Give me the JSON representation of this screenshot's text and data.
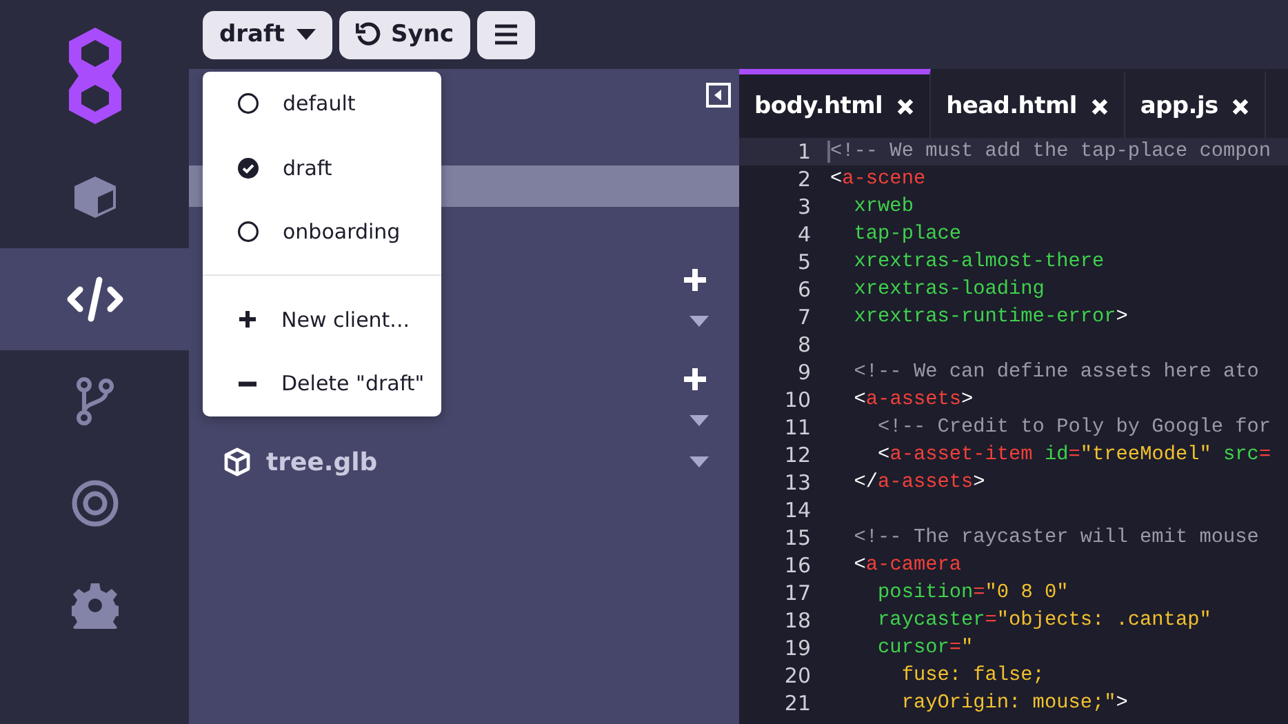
{
  "rail": {
    "items": [
      {
        "kind": "cube",
        "selected": false
      },
      {
        "kind": "code",
        "selected": true
      },
      {
        "kind": "branch",
        "selected": false
      },
      {
        "kind": "target",
        "selected": false
      },
      {
        "kind": "gear",
        "selected": false
      }
    ]
  },
  "toolbar": {
    "client_button": "draft",
    "sync_button": "Sync"
  },
  "client_menu": {
    "clients": [
      {
        "label": "default",
        "selected": false
      },
      {
        "label": "draft",
        "selected": true
      },
      {
        "label": "onboarding",
        "selected": false
      }
    ],
    "actions": [
      {
        "kind": "add",
        "label": "New client..."
      },
      {
        "kind": "remove",
        "label": "Delete \"draft\""
      }
    ]
  },
  "file_panel": {
    "highlight_row": {
      "selected": true
    },
    "files": [
      {
        "name": "tree.glb"
      }
    ]
  },
  "editor": {
    "tabs": [
      {
        "label": "body.html",
        "selected": true
      },
      {
        "label": "head.html",
        "selected": false
      },
      {
        "label": "app.js",
        "selected": false
      }
    ],
    "lines": [
      {
        "number": "1",
        "active": true,
        "tokens": [
          {
            "kind": "comment",
            "text": "<!-- We must add the tap-place compon"
          }
        ]
      },
      {
        "number": "2",
        "active": false,
        "tokens": [
          {
            "kind": "punct",
            "text": "<"
          },
          {
            "kind": "tag",
            "text": "a-scene"
          }
        ]
      },
      {
        "number": "3",
        "active": false,
        "tokens": [
          {
            "kind": "attr",
            "text": "  xrweb"
          }
        ]
      },
      {
        "number": "4",
        "active": false,
        "tokens": [
          {
            "kind": "attr",
            "text": "  tap-place"
          }
        ]
      },
      {
        "number": "5",
        "active": false,
        "tokens": [
          {
            "kind": "attr",
            "text": "  xrextras-almost-there"
          }
        ]
      },
      {
        "number": "6",
        "active": false,
        "tokens": [
          {
            "kind": "attr",
            "text": "  xrextras-loading"
          }
        ]
      },
      {
        "number": "7",
        "active": false,
        "tokens": [
          {
            "kind": "attr",
            "text": "  xrextras-runtime-error"
          },
          {
            "kind": "punct",
            "text": ">"
          }
        ]
      },
      {
        "number": "8",
        "active": false
      },
      {
        "number": "9",
        "active": false,
        "tokens": [
          {
            "kind": "comment",
            "text": "  <!-- We can define assets here ato"
          }
        ]
      },
      {
        "number": "10",
        "active": false,
        "tokens": [
          {
            "kind": "punct",
            "text": "  <"
          },
          {
            "kind": "tag",
            "text": "a-assets"
          },
          {
            "kind": "punct",
            "text": ">"
          }
        ]
      },
      {
        "number": "11",
        "active": false,
        "tokens": [
          {
            "kind": "comment",
            "text": "    <!-- Credit to Poly by Google for"
          }
        ]
      },
      {
        "number": "12",
        "active": false,
        "tokens": [
          {
            "kind": "punct",
            "text": "    <"
          },
          {
            "kind": "tag",
            "text": "a-asset-item"
          },
          {
            "kind": "attr",
            "text": " id"
          },
          {
            "kind": "eq",
            "text": "="
          },
          {
            "kind": "str",
            "text": "\"treeModel\""
          },
          {
            "kind": "attr",
            "text": " src"
          },
          {
            "kind": "eq",
            "text": "="
          }
        ]
      },
      {
        "number": "13",
        "active": false,
        "tokens": [
          {
            "kind": "punct",
            "text": "  </"
          },
          {
            "kind": "tag",
            "text": "a-assets"
          },
          {
            "kind": "punct",
            "text": ">"
          }
        ]
      },
      {
        "number": "14",
        "active": false
      },
      {
        "number": "15",
        "active": false,
        "tokens": [
          {
            "kind": "comment",
            "text": "  <!-- The raycaster will emit mouse"
          }
        ]
      },
      {
        "number": "16",
        "active": false,
        "tokens": [
          {
            "kind": "punct",
            "text": "  <"
          },
          {
            "kind": "tag",
            "text": "a-camera"
          }
        ]
      },
      {
        "number": "17",
        "active": false,
        "tokens": [
          {
            "kind": "attr",
            "text": "    position"
          },
          {
            "kind": "eq",
            "text": "="
          },
          {
            "kind": "str",
            "text": "\"0 8 0\""
          }
        ]
      },
      {
        "number": "18",
        "active": false,
        "tokens": [
          {
            "kind": "attr",
            "text": "    raycaster"
          },
          {
            "kind": "eq",
            "text": "="
          },
          {
            "kind": "str",
            "text": "\"objects: .cantap\""
          }
        ]
      },
      {
        "number": "19",
        "active": false,
        "tokens": [
          {
            "kind": "attr",
            "text": "    cursor"
          },
          {
            "kind": "eq",
            "text": "="
          },
          {
            "kind": "str",
            "text": "\""
          }
        ]
      },
      {
        "number": "20",
        "active": false,
        "tokens": [
          {
            "kind": "str",
            "text": "      fuse: false;"
          }
        ]
      },
      {
        "number": "21",
        "active": false,
        "tokens": [
          {
            "kind": "str",
            "text": "      rayOrigin: mouse;\""
          },
          {
            "kind": "punct",
            "text": ">"
          }
        ]
      }
    ]
  }
}
